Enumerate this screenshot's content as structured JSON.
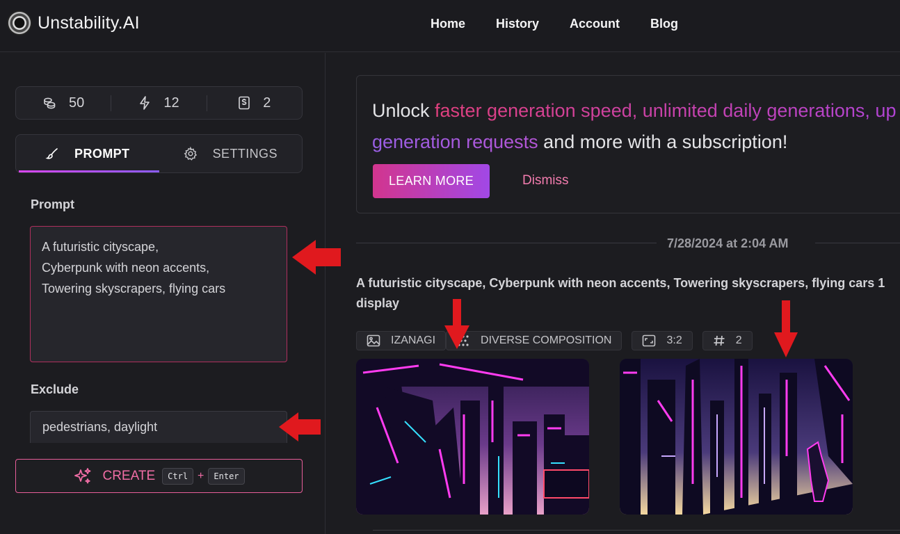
{
  "header": {
    "brand": "Unstability.AI",
    "nav": [
      "Home",
      "History",
      "Account",
      "Blog"
    ]
  },
  "sidebar": {
    "stats": [
      {
        "icon": "coins-icon",
        "value": "50"
      },
      {
        "icon": "bolt-icon",
        "value": "12"
      },
      {
        "icon": "receipt-dollar-icon",
        "value": "2"
      }
    ],
    "tabs": [
      {
        "icon": "brush-icon",
        "label": "PROMPT",
        "active": true
      },
      {
        "icon": "gear-icon",
        "label": "SETTINGS",
        "active": false
      }
    ],
    "prompt_label": "Prompt",
    "prompt_value": "A futuristic cityscape,\nCyberpunk with neon accents,\nTowering skyscrapers, flying cars",
    "exclude_label": "Exclude",
    "exclude_value": "pedestrians, daylight",
    "create_label": "CREATE",
    "shortcut_keys": [
      "Ctrl",
      "Enter"
    ],
    "shortcut_plus": "+"
  },
  "promo": {
    "text_before": "Unlock ",
    "highlight_1": "faster generation speed, unlimited daily generations, up",
    "highlight_2": "generation requests",
    "text_after": " and more with a subscription!",
    "learn_more": "LEARN MORE",
    "dismiss": "Dismiss"
  },
  "generation": {
    "timestamp": "7/28/2024 at 2:04 AM",
    "prompt_text": "A futuristic cityscape, Cyberpunk with neon accents, Towering skyscrapers, flying cars 1 display",
    "chips": [
      {
        "icon": "image-icon",
        "label": "IZANAGI"
      },
      {
        "icon": "dots-icon",
        "label": "DIVERSE COMPOSITION"
      },
      {
        "icon": "aspect-ratio-icon",
        "label": "3:2"
      },
      {
        "icon": "hash-icon",
        "label": "2"
      }
    ]
  },
  "colors": {
    "accent_pink": "#e0407e",
    "accent_purple": "#a148e6",
    "annotation_red": "#e0191e",
    "background": "#1c1c20"
  }
}
